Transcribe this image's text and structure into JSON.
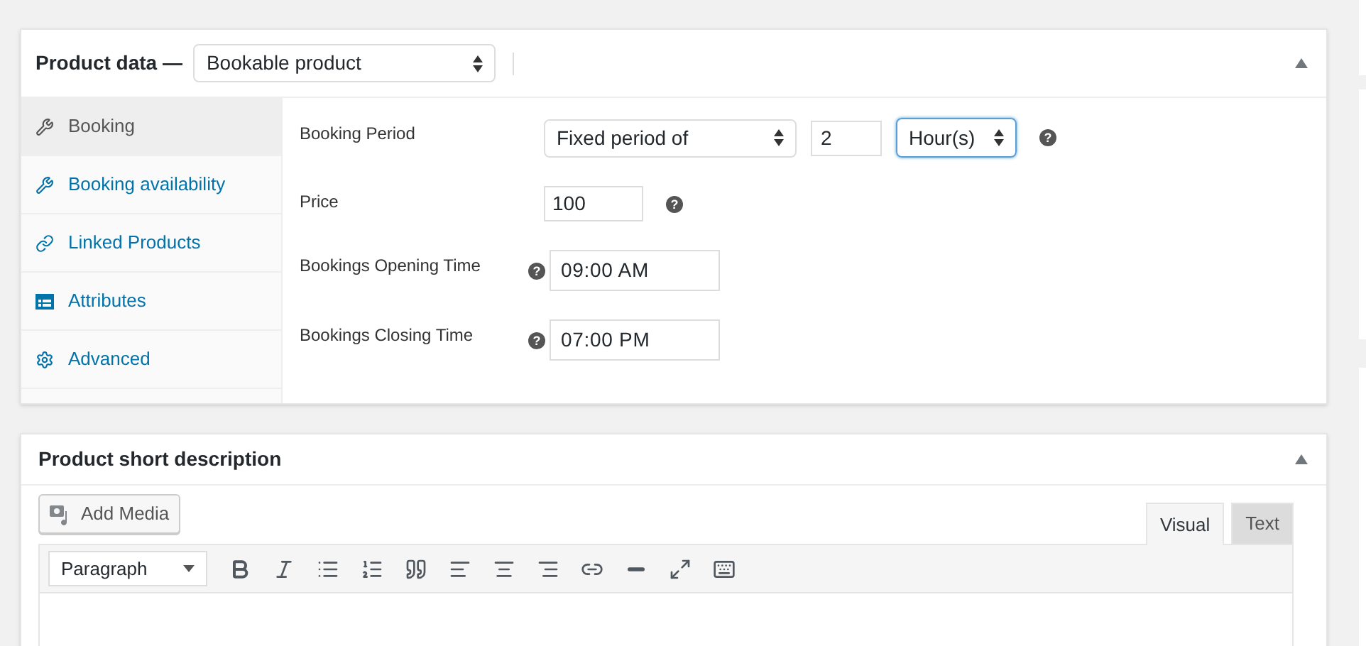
{
  "product_data": {
    "title": "Product data —",
    "product_type": "Bookable product",
    "tabs": [
      {
        "label": "Booking",
        "selected": true
      },
      {
        "label": "Booking availability",
        "selected": false
      },
      {
        "label": "Linked Products",
        "selected": false
      },
      {
        "label": "Attributes",
        "selected": false
      },
      {
        "label": "Advanced",
        "selected": false
      }
    ],
    "fields": [
      {
        "label": "Booking Period",
        "kind": "period",
        "select": "Fixed period of",
        "number": "2",
        "unit": "Hour(s)",
        "unit_focused": true,
        "help": "?"
      },
      {
        "label": "Price",
        "kind": "price",
        "value": "100",
        "help": "?"
      },
      {
        "label": "Bookings Opening Time",
        "kind": "time",
        "value": "09:00 AM",
        "help": "?"
      },
      {
        "label": "Bookings Closing Time",
        "kind": "time",
        "value": "07:00 PM",
        "help": "?"
      }
    ]
  },
  "short_description": {
    "title": "Product short description",
    "add_media": "Add Media",
    "format": "Paragraph",
    "editor_tabs": [
      {
        "label": "Visual",
        "selected": true
      },
      {
        "label": "Text",
        "selected": false
      }
    ]
  }
}
